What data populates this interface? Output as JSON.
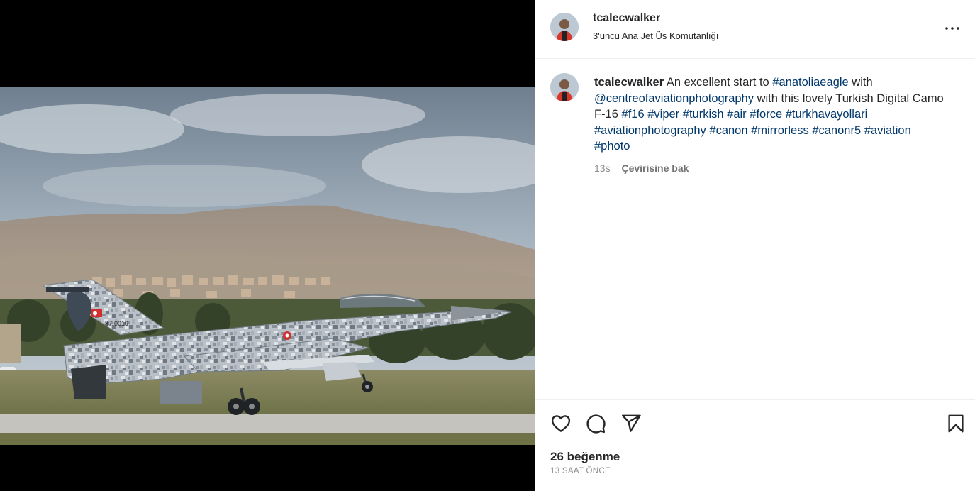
{
  "post": {
    "username": "tcalecwalker",
    "location": "3'üncü Ana Jet Üs Komutanlığı",
    "photo_alt": "Turkish Air Force F-16 in digital camouflage taxiing on runway with hills in background",
    "tail_code": "87-0019"
  },
  "caption": {
    "username": "tcalecwalker",
    "text_1": " An excellent start to ",
    "tag_1": "#anatoliaeagle",
    "text_2": " with ",
    "mention": "@centreofaviationphotography",
    "text_3": " with this lovely Turkish Digital Camo F-16 ",
    "tags": [
      "#f16",
      "#viper",
      "#turkish",
      "#air",
      "#force",
      "#turkhavayollari",
      "#aviationphotography",
      "#canon",
      "#mirrorless",
      "#canonr5",
      "#aviation",
      "#photo"
    ]
  },
  "meta": {
    "age": "13s",
    "see_translation": "Çevirisine bak"
  },
  "footer": {
    "likes": "26 beğenme",
    "timestamp": "13 SAAT ÖNCE"
  },
  "icons": {
    "more": "more-options-icon",
    "like": "heart-icon",
    "comment": "comment-icon",
    "share": "share-icon",
    "save": "bookmark-icon"
  },
  "colors": {
    "text": "#262626",
    "secondary": "#8e8e8e",
    "link": "#00376b"
  }
}
